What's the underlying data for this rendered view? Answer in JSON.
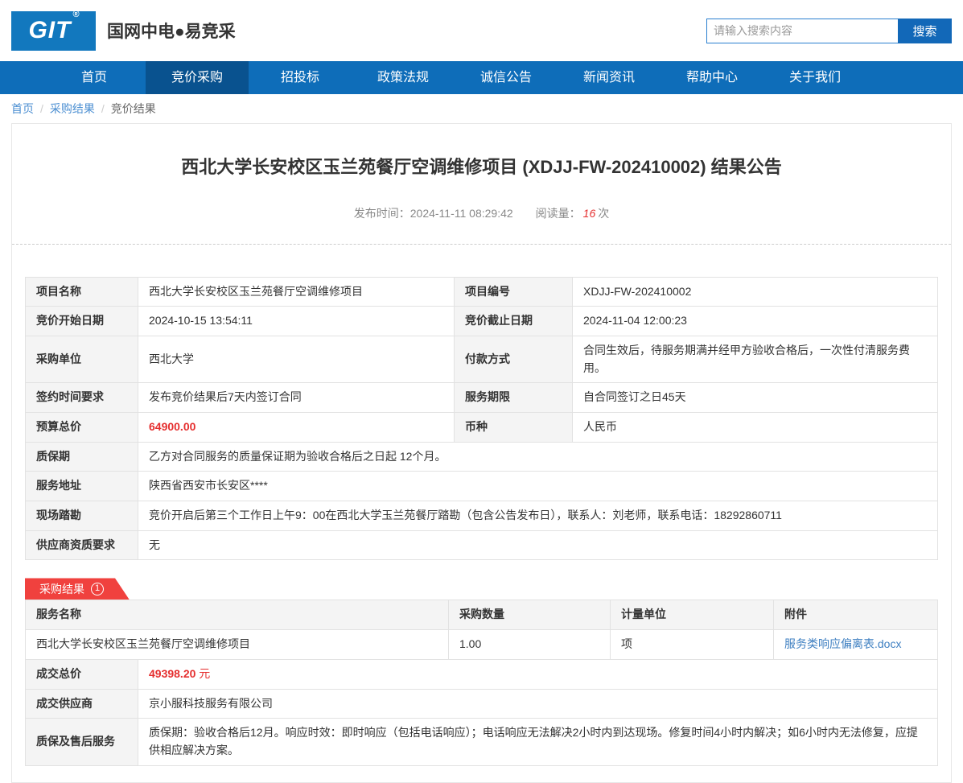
{
  "colors": {
    "brand_blue": "#1278be",
    "nav_blue": "#0e6db9",
    "nav_active_blue": "#09528f",
    "price_red": "#e52f2f",
    "banner_red": "#f0413e",
    "link_blue": "#3e7fc1"
  },
  "brand": {
    "logo_text": "GIT",
    "logo_reg": "®",
    "site_name": "国网中电●易竞采"
  },
  "search": {
    "placeholder": "请输入搜索内容",
    "button_label": "搜索"
  },
  "nav": {
    "items": [
      {
        "label": "首页"
      },
      {
        "label": "竞价采购"
      },
      {
        "label": "招投标"
      },
      {
        "label": "政策法规"
      },
      {
        "label": "诚信公告"
      },
      {
        "label": "新闻资讯"
      },
      {
        "label": "帮助中心"
      },
      {
        "label": "关于我们"
      }
    ]
  },
  "breadcrumb": {
    "home": "首页",
    "sep": "/",
    "level2": "采购结果",
    "current": "竞价结果"
  },
  "article": {
    "title": "西北大学长安校区玉兰苑餐厅空调维修项目 (XDJJ-FW-202410002) 结果公告",
    "publish_label": "发布时间：",
    "publish_time": "2024-11-11 08:29:42",
    "views_label": "阅读量：",
    "views_count": "16",
    "views_unit": "次"
  },
  "info": {
    "project_name_label": "项目名称",
    "project_name": "西北大学长安校区玉兰苑餐厅空调维修项目",
    "project_no_label": "项目编号",
    "project_no": "XDJJ-FW-202410002",
    "start_label": "竞价开始日期",
    "start": "2024-10-15 13:54:11",
    "end_label": "竞价截止日期",
    "end": "2024-11-04 12:00:23",
    "buyer_label": "采购单位",
    "buyer": "西北大学",
    "payment_label": "付款方式",
    "payment": "合同生效后，待服务期满并经甲方验收合格后，一次性付清服务费用。",
    "sign_label": "签约时间要求",
    "sign": "发布竞价结果后7天内签订合同",
    "service_period_label": "服务期限",
    "service_period": "自合同签订之日45天",
    "budget_label": "预算总价",
    "budget": "64900.00",
    "currency_label": "币种",
    "currency": "人民币",
    "warranty_label": "质保期",
    "warranty": "乙方对合同服务的质量保证期为验收合格后之日起 12个月。",
    "address_label": "服务地址",
    "address": "陕西省西安市长安区****",
    "survey_label": "现场踏勘",
    "survey": "竞价开启后第三个工作日上午9：00在西北大学玉兰苑餐厅踏勘（包含公告发布日），联系人：刘老师，联系电话：18292860711",
    "qualification_label": "供应商资质要求",
    "qualification": "无"
  },
  "result": {
    "badge_label": "采购结果",
    "badge_count": "1",
    "headers": {
      "service_name": "服务名称",
      "quantity": "采购数量",
      "unit": "计量单位",
      "attachment": "附件"
    },
    "item": {
      "service_name": "西北大学长安校区玉兰苑餐厅空调维修项目",
      "quantity": "1.00",
      "unit": "项",
      "attachment": "服务类响应偏离表.docx"
    },
    "total_label": "成交总价",
    "total_value": "49398.20",
    "total_unit": "元",
    "supplier_label": "成交供应商",
    "supplier": "京小服科技服务有限公司",
    "aftersale_label": "质保及售后服务",
    "aftersale": "质保期：验收合格后12月。响应时效：即时响应（包括电话响应）；电话响应无法解决2小时内到达现场。修复时间4小时内解决；如6小时内无法修复，应提供相应解决方案。"
  }
}
